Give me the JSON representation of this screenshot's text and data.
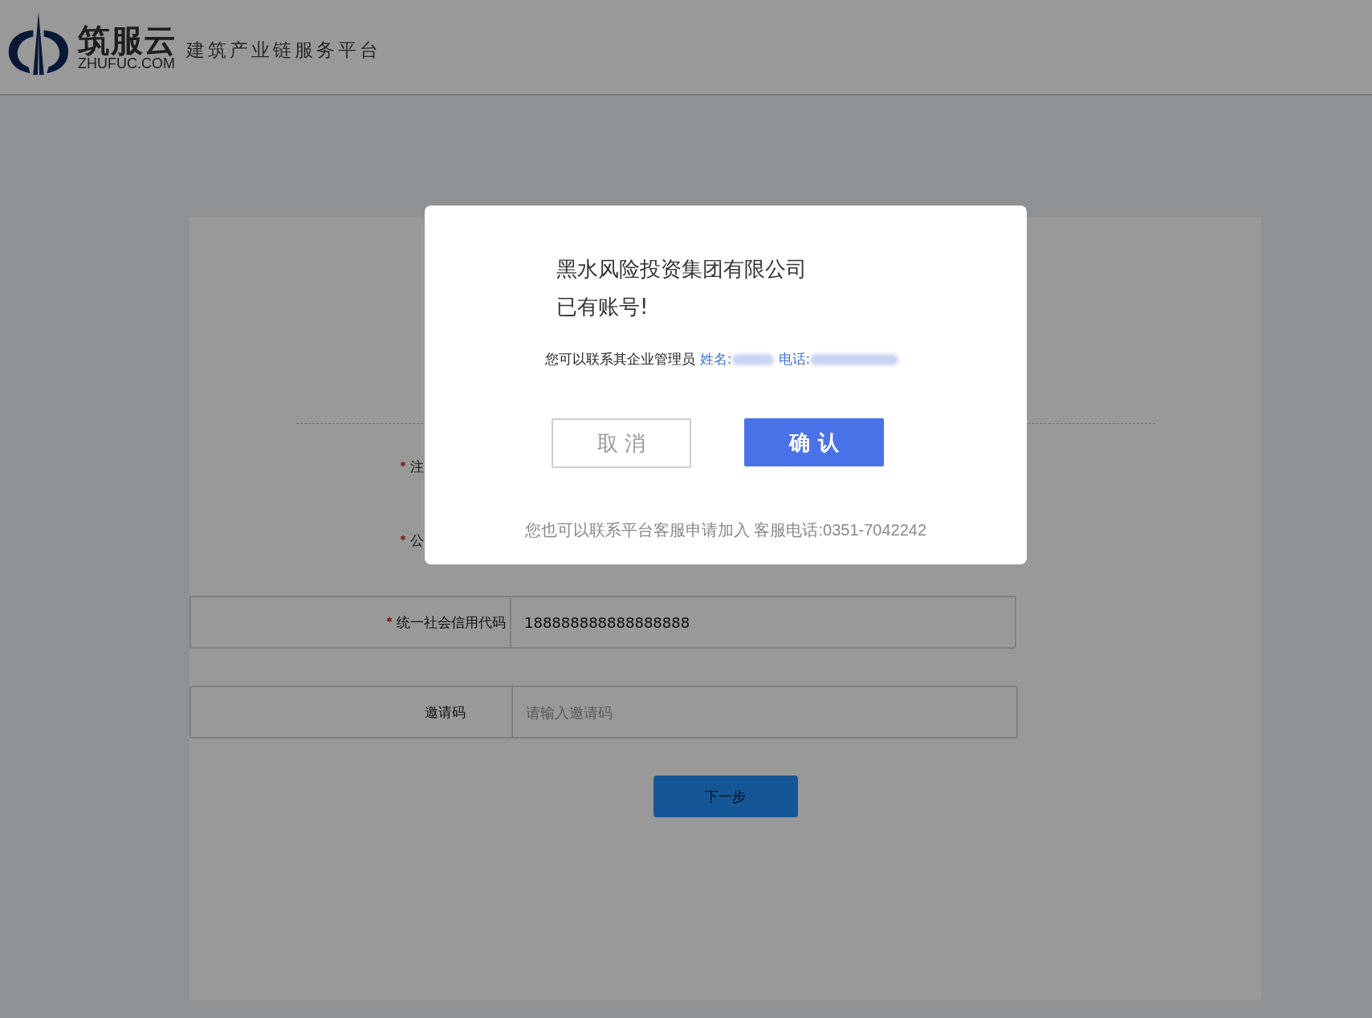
{
  "header": {
    "brand": "筑服云",
    "domain": "ZHUFUC.COM",
    "tagline": "建筑产业链服务平台"
  },
  "form": {
    "fields": [
      {
        "label": "注",
        "required": true,
        "kind": "hidden"
      },
      {
        "label": "公",
        "required": true,
        "kind": "hidden"
      },
      {
        "label": "统一社会信用代码",
        "required": true,
        "kind": "input",
        "value": "188888888888888888"
      },
      {
        "label": "邀请码",
        "required": false,
        "kind": "input",
        "placeholder": "请输入邀请码"
      }
    ],
    "submit": "下一步"
  },
  "dialog": {
    "company": "黑水风险投资集团有限公司",
    "message": "已有账号!",
    "contact_intro": "您可以联系其企业管理员",
    "name_label": "姓名:",
    "phone_label": "电话:",
    "cancel": "取 消",
    "confirm": "确 认",
    "footer": "您也可以联系平台客服申请加入 客服电话:0351-7042242"
  }
}
